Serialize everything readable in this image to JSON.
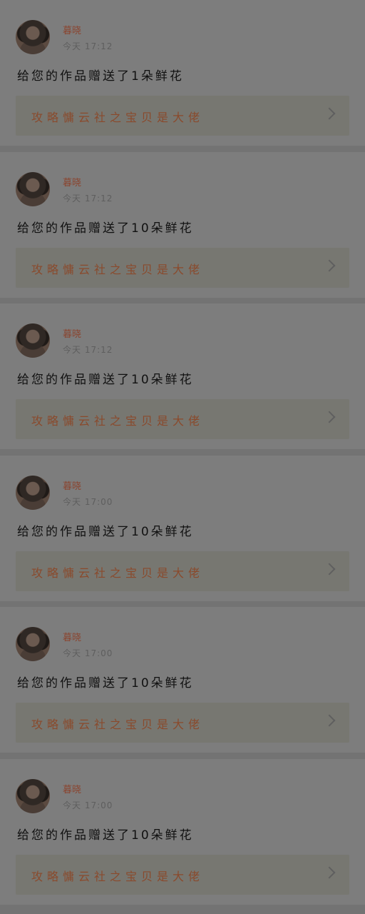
{
  "feed": {
    "items": [
      {
        "username": "暮晓",
        "time": "今天  17:12",
        "message": "给您的作品赠送了1朵鲜花",
        "work_title": "攻略慵云社之宝贝是大佬"
      },
      {
        "username": "暮晓",
        "time": "今天  17:12",
        "message": "给您的作品赠送了10朵鲜花",
        "work_title": "攻略慵云社之宝贝是大佬"
      },
      {
        "username": "暮晓",
        "time": "今天  17:12",
        "message": "给您的作品赠送了10朵鲜花",
        "work_title": "攻略慵云社之宝贝是大佬"
      },
      {
        "username": "暮晓",
        "time": "今天  17:00",
        "message": "给您的作品赠送了10朵鲜花",
        "work_title": "攻略慵云社之宝贝是大佬"
      },
      {
        "username": "暮晓",
        "time": "今天  17:00",
        "message": "给您的作品赠送了10朵鲜花",
        "work_title": "攻略慵云社之宝贝是大佬"
      },
      {
        "username": "暮晓",
        "time": "今天  17:00",
        "message": "给您的作品赠送了10朵鲜花",
        "work_title": "攻略慵云社之宝贝是大佬"
      }
    ]
  }
}
